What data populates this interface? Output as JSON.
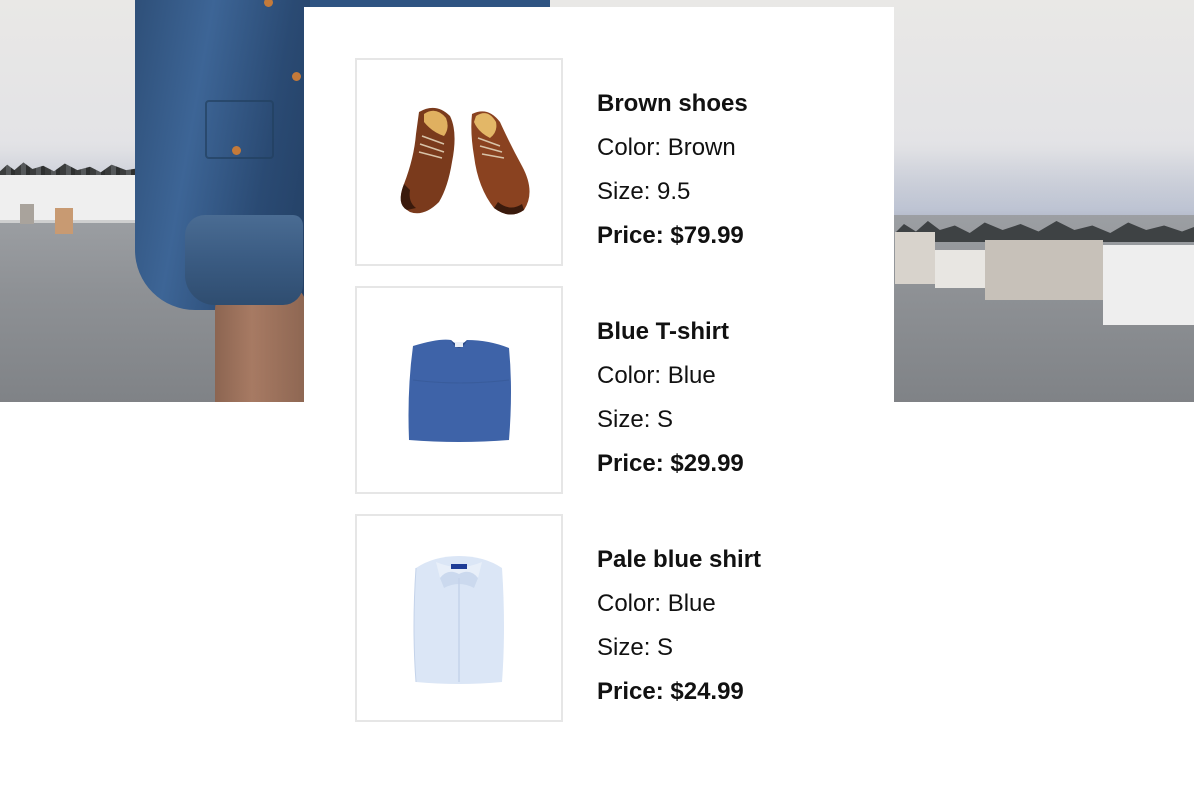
{
  "hero": {
    "image": "man-in-denim-jacket-rooftop-photo"
  },
  "products": [
    {
      "name": "Brown shoes",
      "color": "Color: Brown",
      "size": "Size: 9.5",
      "price": "Price: $79.99",
      "image_icon": "brown-shoes-image"
    },
    {
      "name": "Blue T-shirt",
      "color": "Color: Blue",
      "size": "Size: S",
      "price": "Price: $29.99",
      "image_icon": "blue-tshirt-image"
    },
    {
      "name": "Pale blue shirt",
      "color": "Color: Blue",
      "size": "Size: S",
      "price": "Price: $24.99",
      "image_icon": "pale-blue-shirt-image"
    }
  ],
  "colors": {
    "background": "#ffffff",
    "text": "#111111",
    "thumb_border": "#e6e6e6"
  }
}
